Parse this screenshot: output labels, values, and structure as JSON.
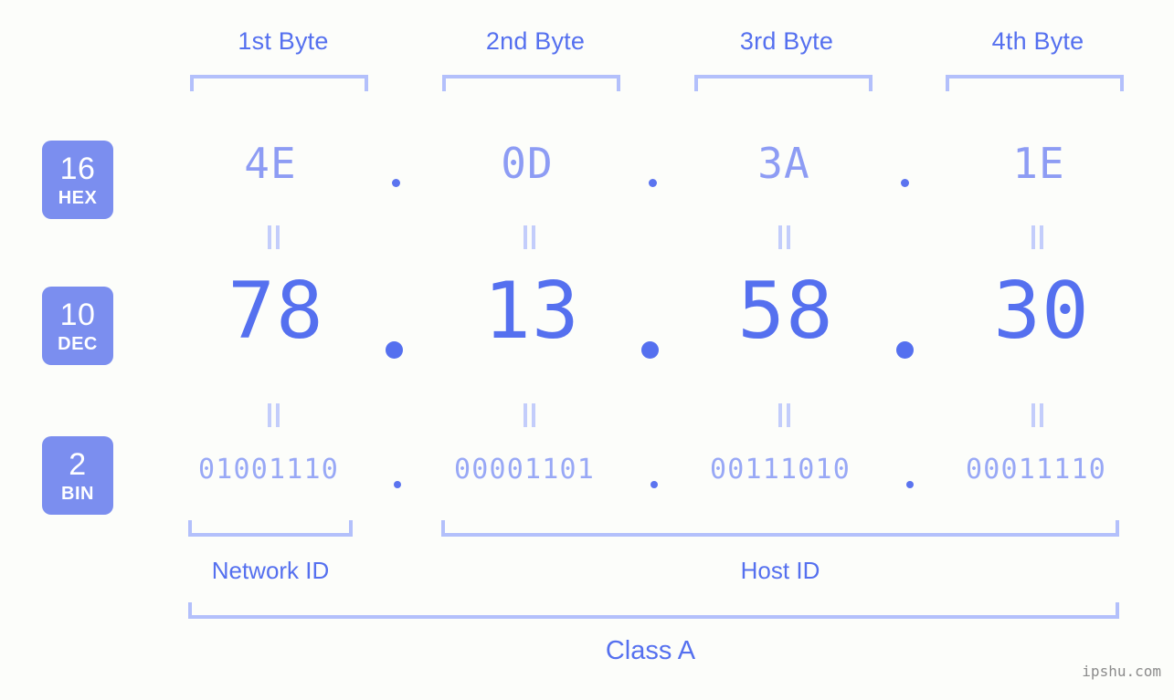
{
  "background_color": "#fcfdfa",
  "accent_colors": {
    "badge_fill": "#7b8eef",
    "badge_text": "#ffffff",
    "header_text": "#5570ef",
    "hex_text": "#8d9cf4",
    "dec_text": "#5570ef",
    "bin_text": "#98a8f6",
    "bracket": "#b3c0fb",
    "equals_mark": "#c3cdfb",
    "dot": "#5b74ef",
    "watermark": "#8b8b8b"
  },
  "byte_headers": [
    {
      "label": "1st Byte"
    },
    {
      "label": "2nd Byte"
    },
    {
      "label": "3rd Byte"
    },
    {
      "label": "4th Byte"
    }
  ],
  "rows": [
    {
      "badge_number": "16",
      "badge_label": "HEX",
      "values": [
        "4E",
        "0D",
        "3A",
        "1E"
      ],
      "separator": "."
    },
    {
      "badge_number": "10",
      "badge_label": "DEC",
      "values": [
        "78",
        "13",
        "58",
        "30"
      ],
      "separator": "."
    },
    {
      "badge_number": "2",
      "badge_label": "BIN",
      "values": [
        "01001110",
        "00001101",
        "00111010",
        "00011110"
      ],
      "separator": "."
    }
  ],
  "equals_marks": {
    "glyph": "=",
    "count_per_gap": 4,
    "gaps": 2
  },
  "id_sections": [
    {
      "label": "Network ID"
    },
    {
      "label": "Host ID"
    }
  ],
  "class_section": {
    "label": "Class A"
  },
  "watermark": {
    "text": "ipshu.com"
  }
}
